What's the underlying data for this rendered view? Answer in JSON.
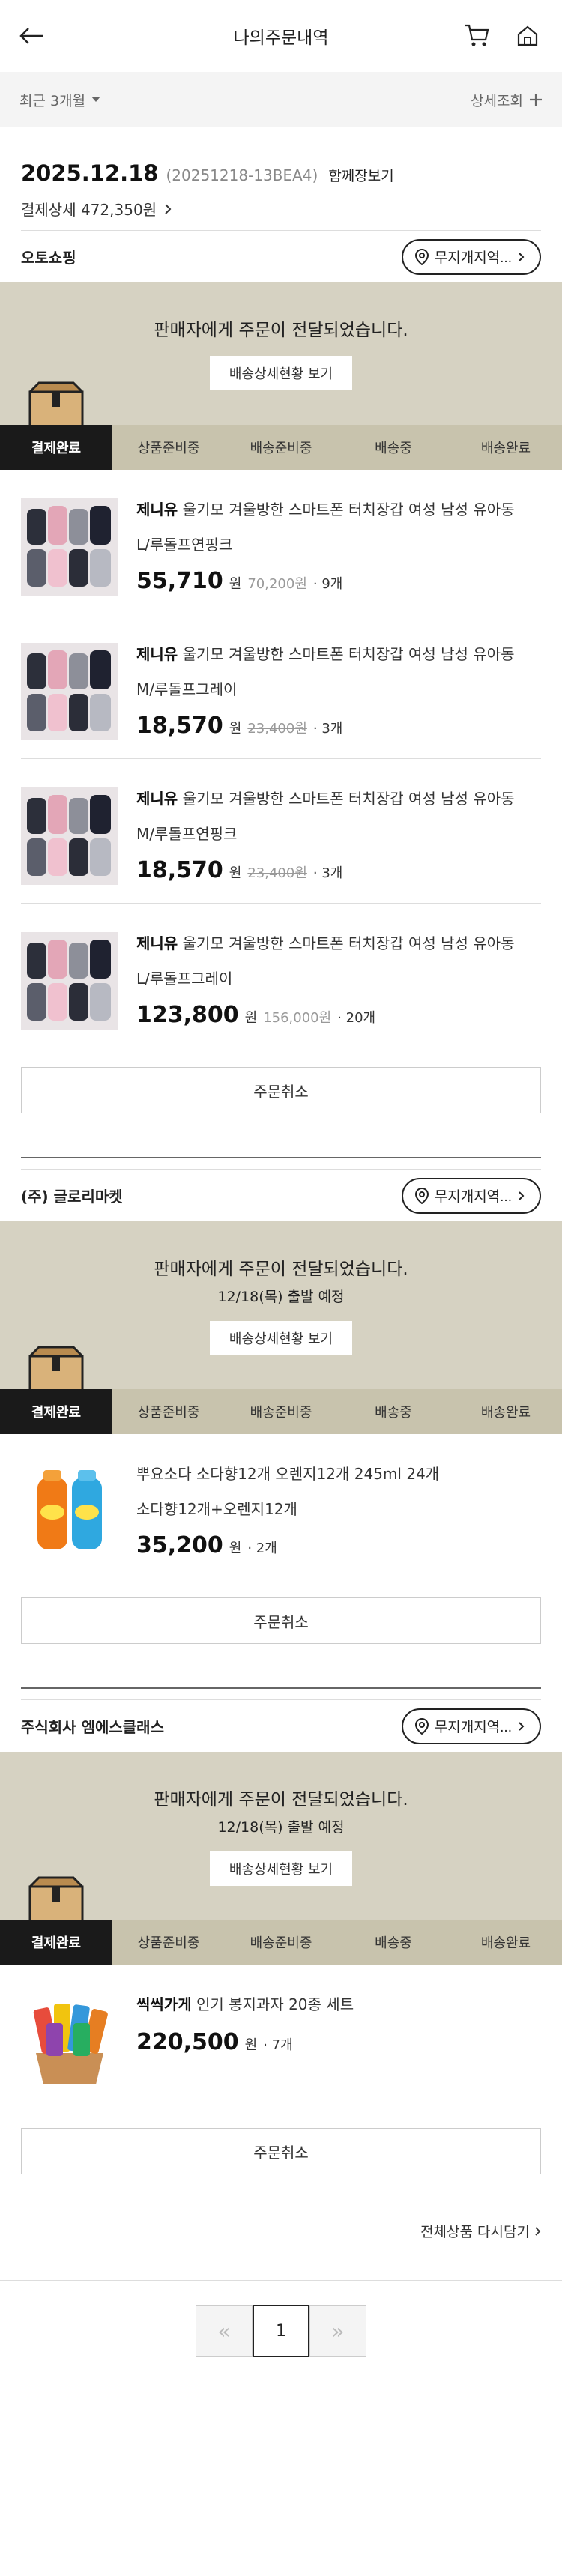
{
  "header": {
    "title": "나의주문내역"
  },
  "filter": {
    "period": "최근 3개월",
    "detail": "상세조회"
  },
  "order": {
    "date": "2025.12.18",
    "order_no": "(20251218-13BEA4)",
    "view_all": "함께장보기",
    "payment": "결제상세 472,350원"
  },
  "sellers": [
    {
      "name": "오토쇼핑",
      "store_button": "무지개지역...",
      "banner_msg": "판매자에게 주문이 전달되었습니다.",
      "banner_sub": "",
      "track_label": "배송상세현황 보기",
      "steps": [
        "결제완료",
        "상품준비중",
        "배송준비중",
        "배송중",
        "배송완료"
      ],
      "items": [
        {
          "brand": "제니유",
          "name": "울기모 겨울방한 스마트폰 터치장갑 여성 남성 유아동",
          "option": "L/루돌프연핑크",
          "price": "55,710",
          "won": "원",
          "orig": "70,200원",
          "qty": "· 9개"
        },
        {
          "brand": "제니유",
          "name": "울기모 겨울방한 스마트폰 터치장갑 여성 남성 유아동",
          "option": "M/루돌프그레이",
          "price": "18,570",
          "won": "원",
          "orig": "23,400원",
          "qty": "· 3개"
        },
        {
          "brand": "제니유",
          "name": "울기모 겨울방한 스마트폰 터치장갑 여성 남성 유아동",
          "option": "M/루돌프연핑크",
          "price": "18,570",
          "won": "원",
          "orig": "23,400원",
          "qty": "· 3개"
        },
        {
          "brand": "제니유",
          "name": "울기모 겨울방한 스마트폰 터치장갑 여성 남성 유아동",
          "option": "L/루돌프그레이",
          "price": "123,800",
          "won": "원",
          "orig": "156,000원",
          "qty": "· 20개"
        }
      ],
      "cancel": "주문취소"
    },
    {
      "name": "(주) 글로리마켓",
      "store_button": "무지개지역...",
      "banner_msg": "판매자에게 주문이 전달되었습니다.",
      "banner_sub": "12/18(목) 출발 예정",
      "track_label": "배송상세현황 보기",
      "steps": [
        "결제완료",
        "상품준비중",
        "배송준비중",
        "배송중",
        "배송완료"
      ],
      "items": [
        {
          "brand": "",
          "name": "뿌요소다 소다향12개 오렌지12개 245ml 24개",
          "option": "소다향12개+오렌지12개",
          "price": "35,200",
          "won": "원",
          "orig": "",
          "qty": "· 2개"
        }
      ],
      "cancel": "주문취소"
    },
    {
      "name": "주식회사 엠에스클래스",
      "store_button": "무지개지역...",
      "banner_msg": "판매자에게 주문이 전달되었습니다.",
      "banner_sub": "12/18(목) 출발 예정",
      "track_label": "배송상세현황 보기",
      "steps": [
        "결제완료",
        "상품준비중",
        "배송준비중",
        "배송중",
        "배송완료"
      ],
      "items": [
        {
          "brand": "씩씩가게",
          "name": "인기 봉지과자 20종 세트",
          "option": "",
          "price": "220,500",
          "won": "원",
          "orig": "",
          "qty": "· 7개"
        }
      ],
      "cancel": "주문취소"
    }
  ],
  "reorder": "전체상품 다시담기",
  "pagination": {
    "current": "1",
    "prev": "«",
    "next": "»"
  },
  "colors": {
    "banner": "#d6d2c2",
    "steps_bg": "#c8c3ad",
    "active_step": "#1a1a1a"
  }
}
